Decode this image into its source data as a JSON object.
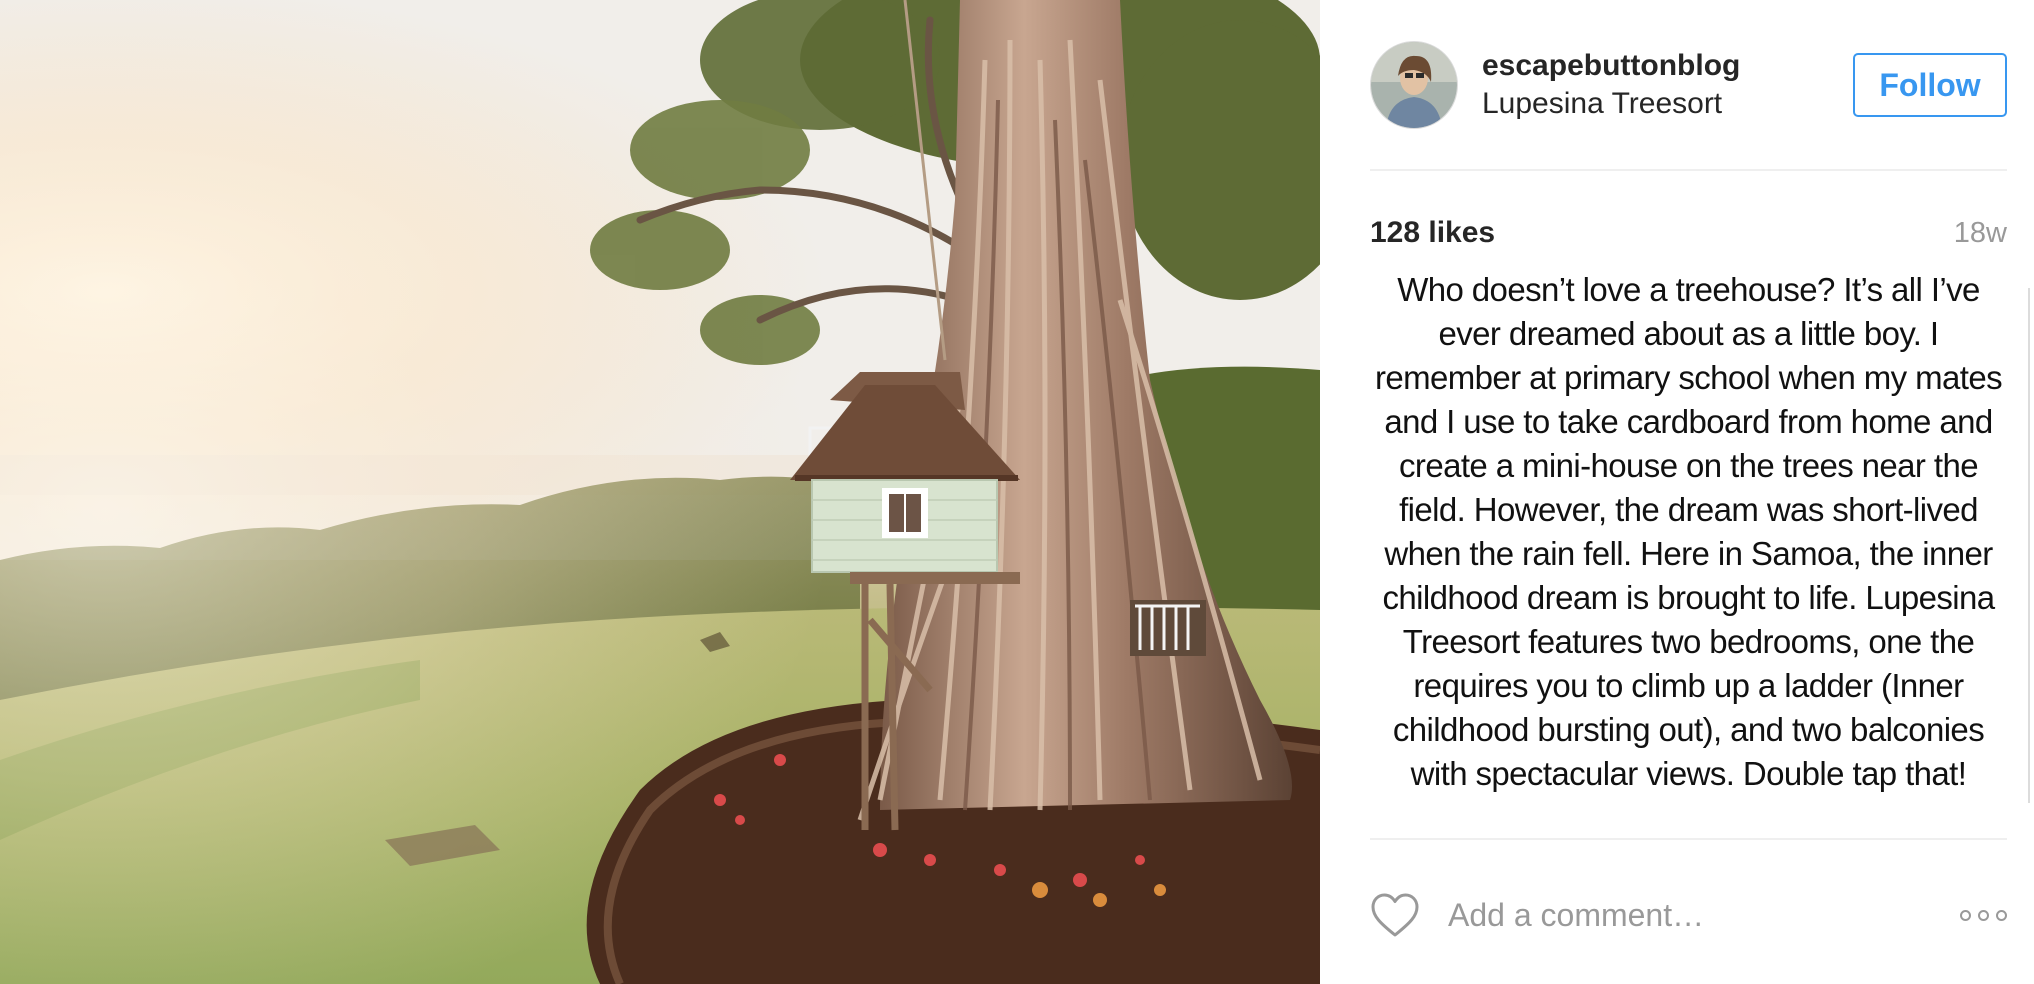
{
  "post": {
    "image_alt": "Lupesina Treesort treehouse in Samoa",
    "header": {
      "username": "escapebuttonblog",
      "location": "Lupesina Treesort",
      "follow_label": "Follow",
      "follow_color": "#3897f0"
    },
    "likes": "128 likes",
    "time_ago": "18w",
    "caption": "Who doesn’t love a treehouse? It’s all I’ve ever dreamed about as a little boy. I remember at primary school when my mates and I use to take cardboard from home and create a mini-house on the trees near the field. However, the dream was short-lived when the rain fell. Here in Samoa, the inner childhood dream is brought to life. Lupesina Treesort features two bedrooms, one the requires you to climb up a ladder (Inner childhood bursting out), and two balconies with spectacular views. Double tap that!",
    "comment": {
      "placeholder": "Add a comment…",
      "value": ""
    },
    "icons": {
      "like": "heart-outline-icon",
      "more": "more-options-icon"
    }
  }
}
